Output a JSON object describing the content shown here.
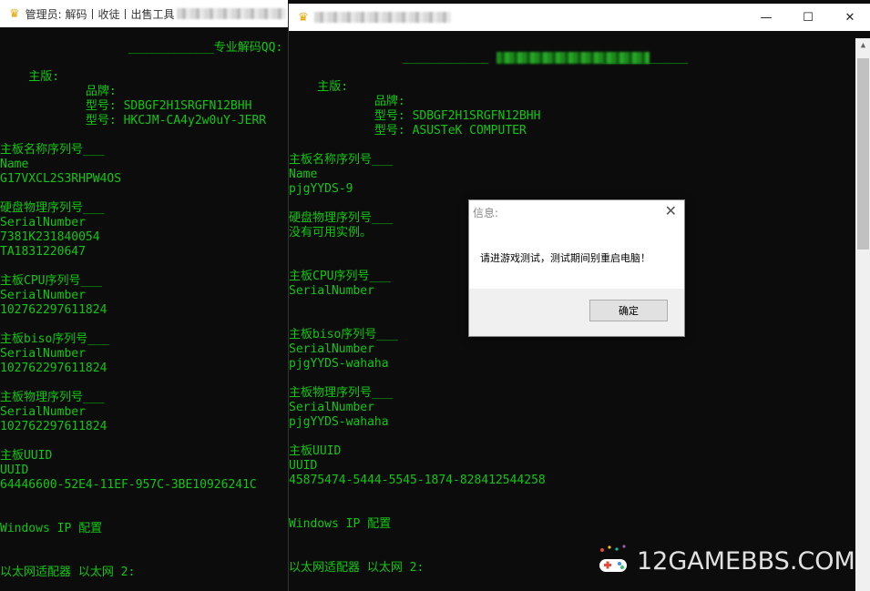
{
  "left_window": {
    "title": "管理员:  解码丨收徒丨出售工具",
    "console_lines": [
      "                  ____________专业解码QQ:",
      "",
      "    主版:",
      "            品牌:",
      "            型号: SDBGF2H1SRGFN12BHH",
      "            型号: HKCJM-CA4y2w0uY-JERR",
      "",
      "主板名称序列号___",
      "Name",
      "G17VXCL2S3RHPW4OS",
      "",
      "硬盘物理序列号___",
      "SerialNumber",
      "7381K231840054",
      "TA1831220647",
      "",
      "主板CPU序列号___",
      "SerialNumber",
      "102762297611824",
      "",
      "主板biso序列号___",
      "SerialNumber",
      "102762297611824",
      "",
      "主板物理序列号___",
      "SerialNumber",
      "102762297611824",
      "",
      "主板UUID",
      "UUID",
      "64446600-52E4-11EF-957C-3BE10926241C",
      "",
      "",
      "Windows IP 配置",
      "",
      "",
      "以太网适配器 以太网 2:"
    ]
  },
  "right_window": {
    "title": "",
    "controls": {
      "minimize": "—",
      "maximize": "☐",
      "close": "✕"
    },
    "console_lines": [
      "                ____________                ____________",
      "",
      "    主版:",
      "            品牌:",
      "            型号: SDBGF2H1SRGFN12BHH",
      "            型号: ASUSTeK COMPUTER",
      "",
      "主板名称序列号___",
      "Name",
      "pjgYYDS-9",
      "",
      "硬盘物理序列号___",
      "没有可用实例。",
      "",
      "",
      "主板CPU序列号___",
      "SerialNumber",
      "",
      "",
      "主板biso序列号___",
      "SerialNumber",
      "pjgYYDS-wahaha",
      "",
      "主板物理序列号___",
      "SerialNumber",
      "pjgYYDS-wahaha",
      "",
      "主板UUID",
      "UUID",
      "45875474-5444-5545-1874-828412544258",
      "",
      "",
      "Windows IP 配置",
      "",
      "",
      "以太网适配器 以太网 2:"
    ]
  },
  "dialog": {
    "title": "信息:",
    "message": "请进游戏测试，测试期间别重启电脑！",
    "ok_label": "确定",
    "close": "✕"
  },
  "watermark": {
    "text": "12GAMEBBS.COM"
  }
}
